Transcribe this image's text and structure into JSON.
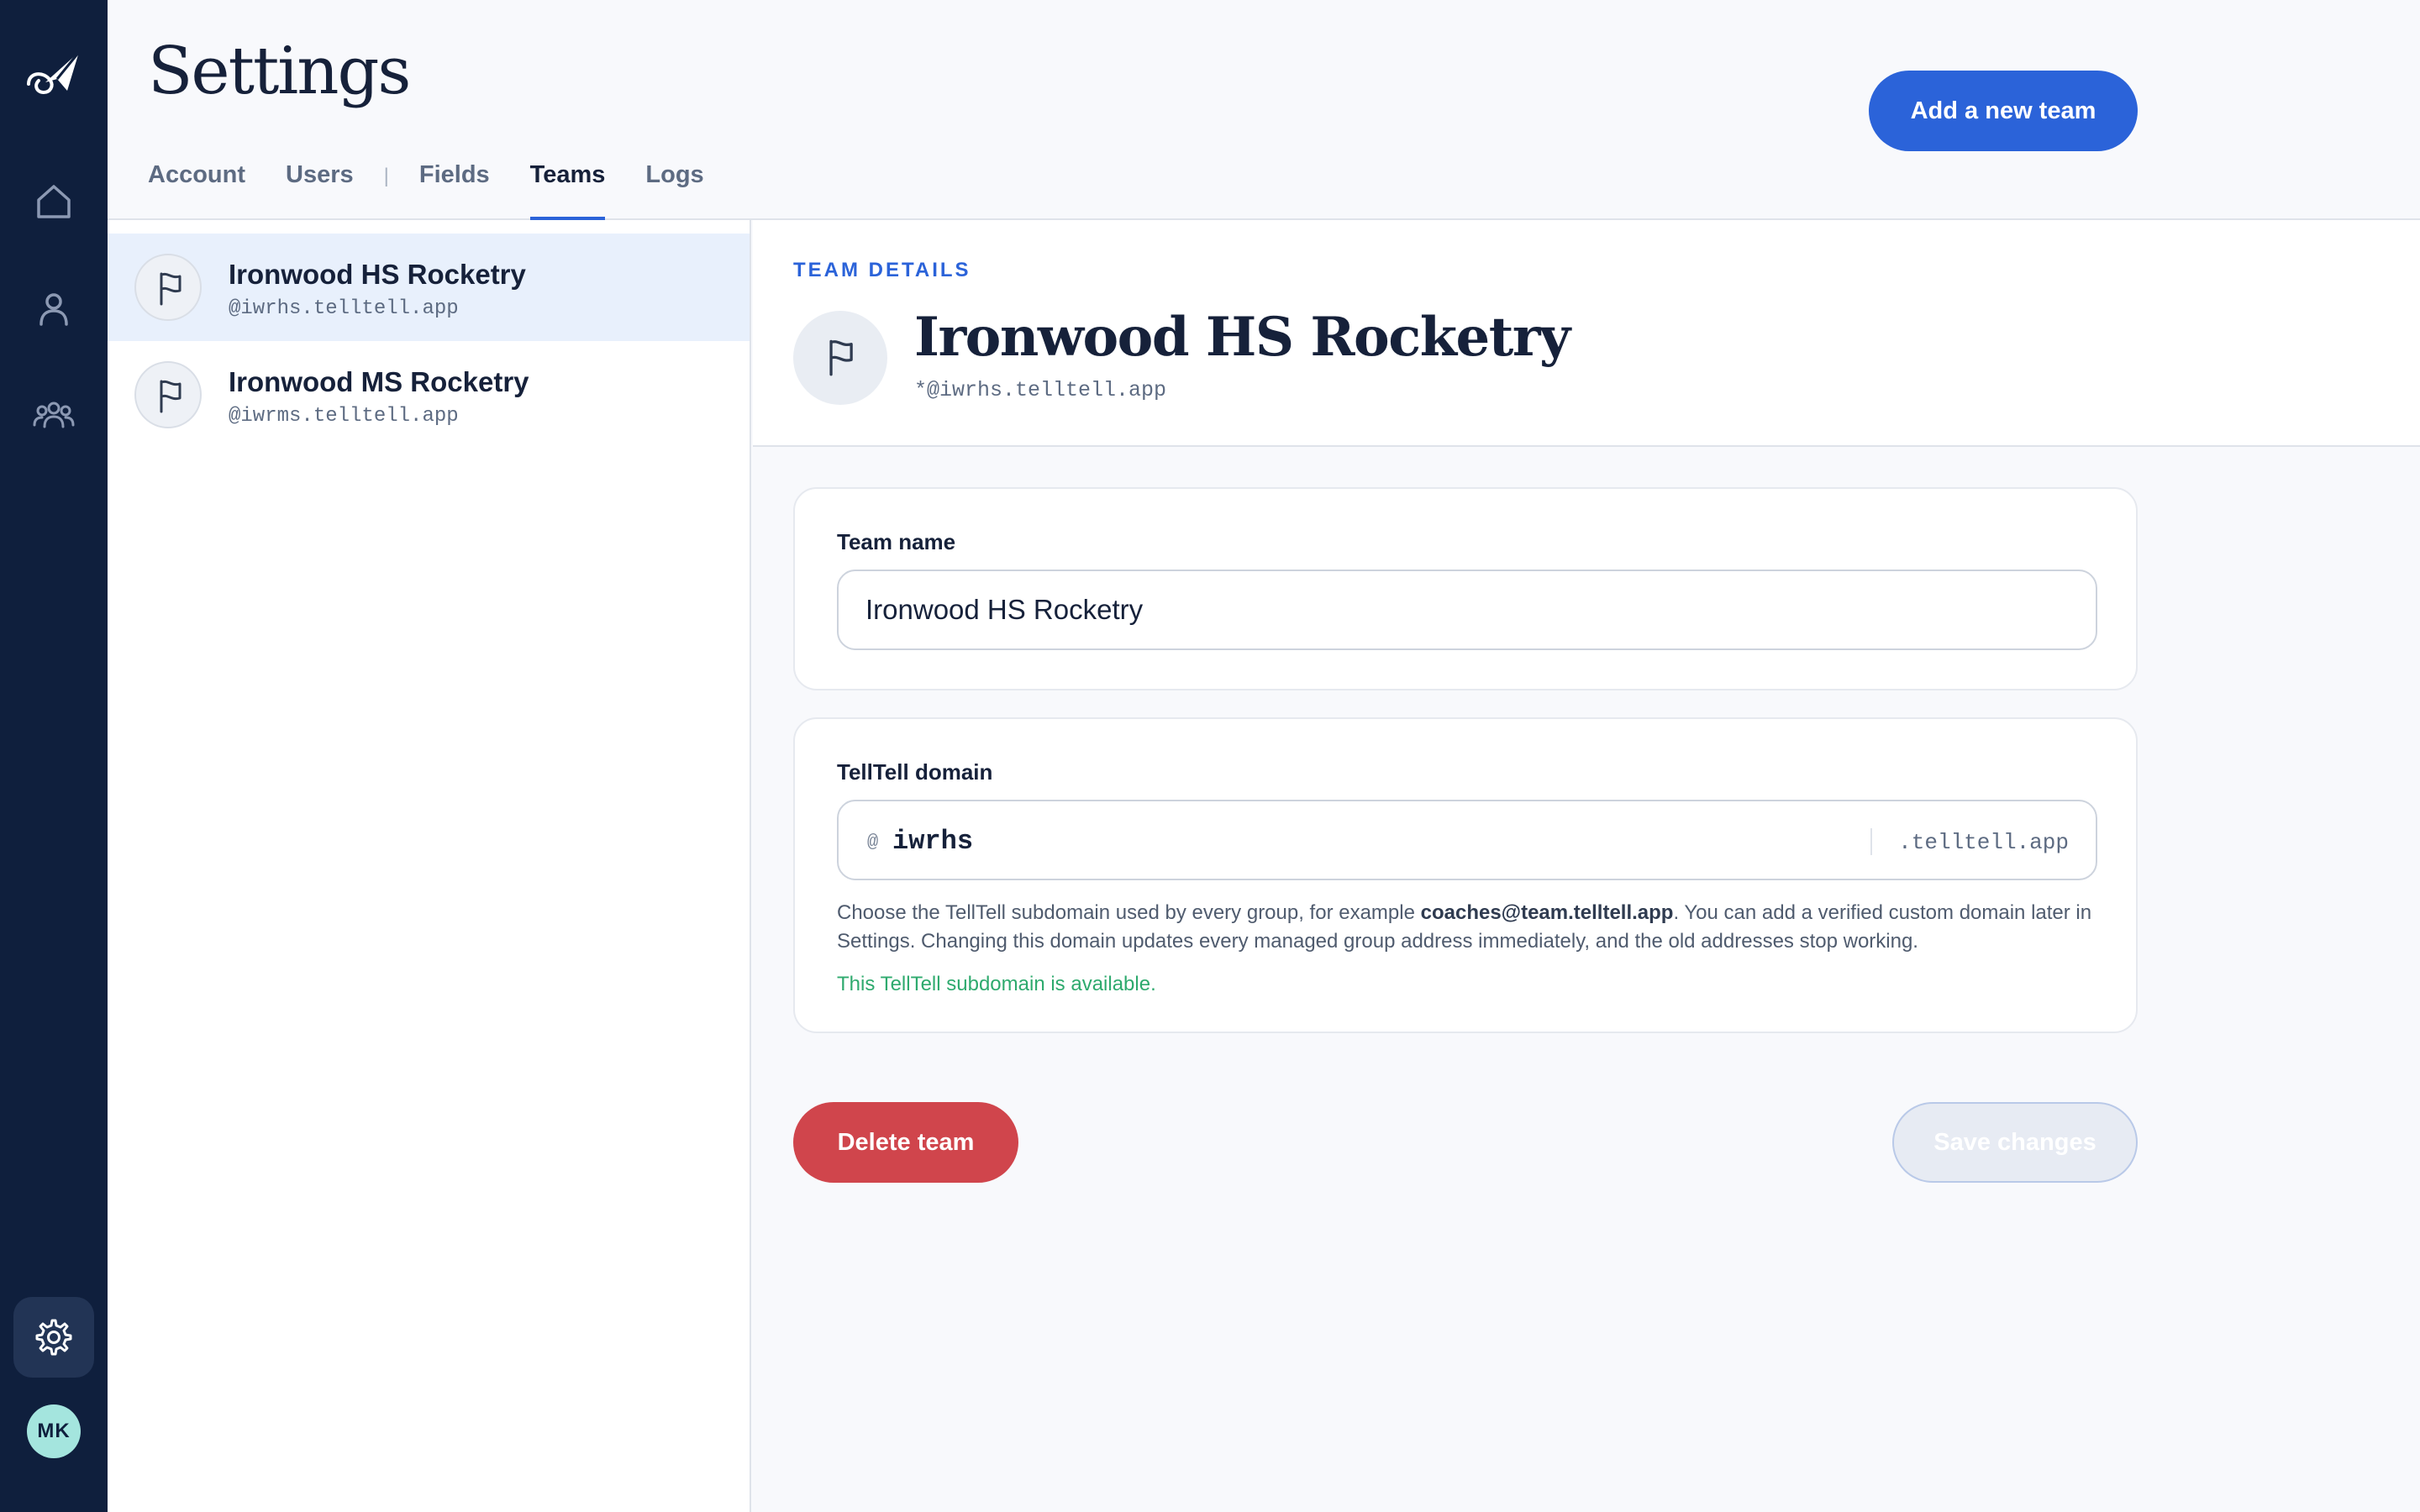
{
  "sidebar": {
    "icons": [
      "paper-plane-logo-icon",
      "home-icon",
      "user-icon",
      "team-icon",
      "gear-icon"
    ],
    "avatar_initials": "MK"
  },
  "header": {
    "title": "Settings",
    "tabs": [
      {
        "label": "Account",
        "active": false
      },
      {
        "label": "Users",
        "active": false
      },
      {
        "label": "Fields",
        "active": false
      },
      {
        "label": "Teams",
        "active": true
      },
      {
        "label": "Logs",
        "active": false
      }
    ],
    "add_button_label": "Add a new team"
  },
  "teams": [
    {
      "name": "Ironwood HS Rocketry",
      "handle": "@iwrhs.telltell.app",
      "selected": true
    },
    {
      "name": "Ironwood MS Rocketry",
      "handle": "@iwrms.telltell.app",
      "selected": false
    }
  ],
  "details": {
    "section_label": "TEAM DETAILS",
    "name": "Ironwood HS Rocketry",
    "handle": "*@iwrhs.telltell.app",
    "team_name_label": "Team name",
    "team_name_value": "Ironwood HS Rocketry",
    "domain_label": "TellTell domain",
    "domain_prefix": "@",
    "domain_value": "iwrhs",
    "domain_suffix": ".telltell.app",
    "help_part1": "Choose the TellTell subdomain used by every group, for example ",
    "help_example": "coaches@team.telltell.app",
    "help_part2": ". You can add a verified custom domain later in Settings. Changing this domain updates every managed group address immediately, and the old addresses stop working.",
    "availability": "This TellTell subdomain is available.",
    "delete_label": "Delete team",
    "save_label": "Save changes"
  },
  "colors": {
    "rail": "#0f1f3d",
    "accent": "#2b63d9",
    "danger": "#d0454c",
    "success": "#2eaa6e"
  }
}
